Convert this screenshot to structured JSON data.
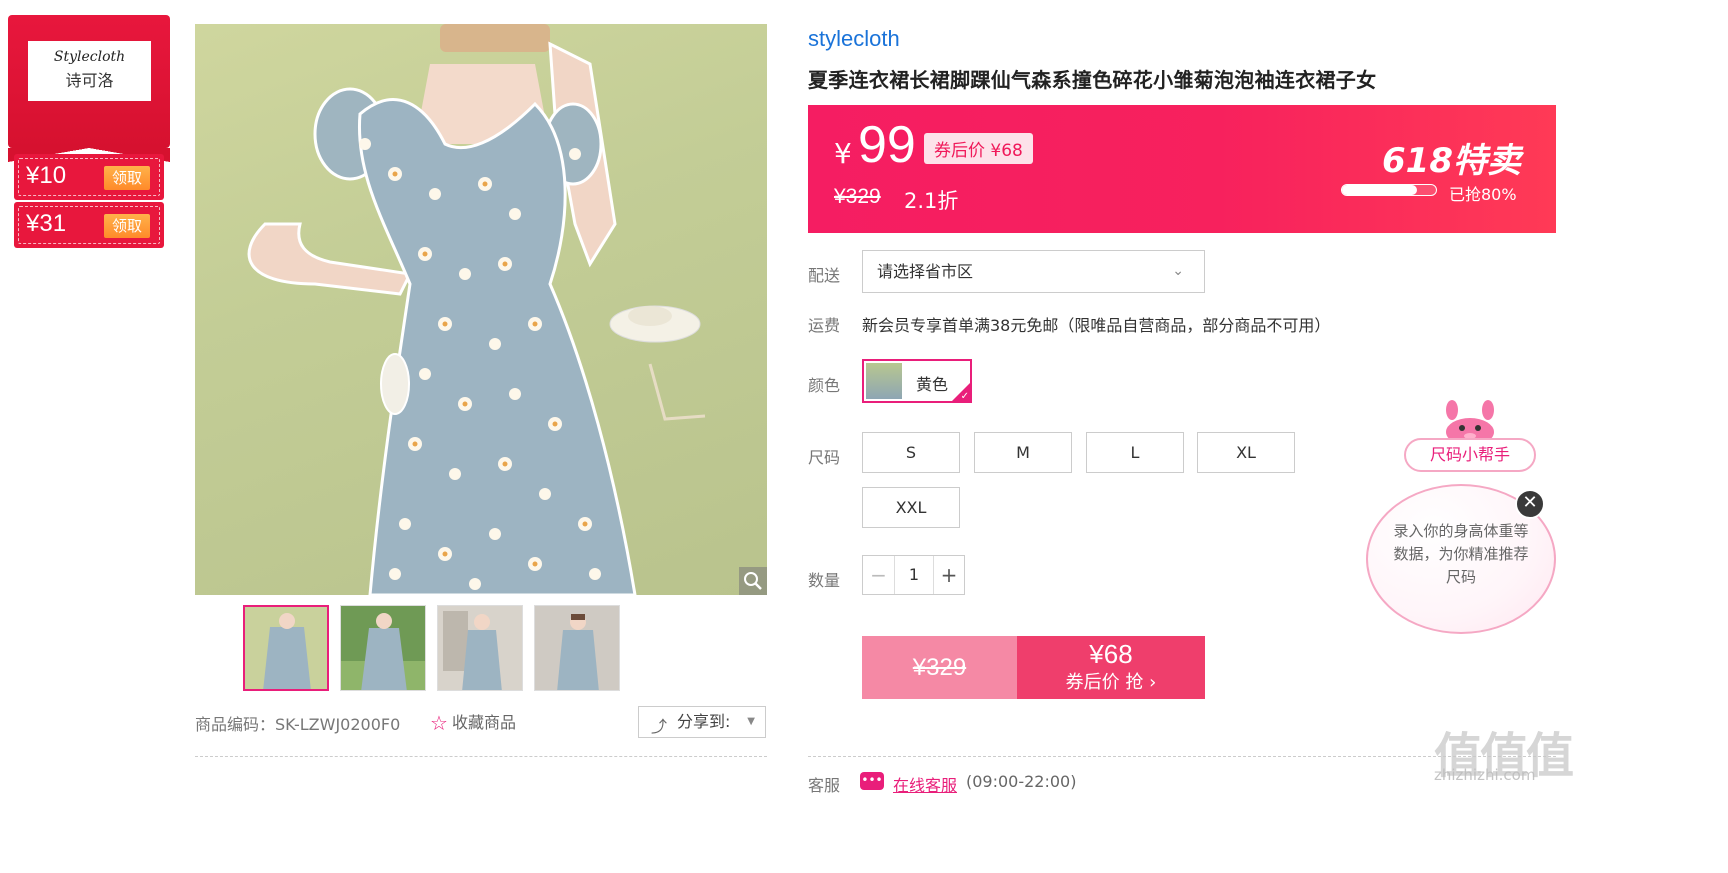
{
  "brand": {
    "name_en": "Stylecloth",
    "name_cn": "诗可洛"
  },
  "coupons": [
    {
      "amount": "¥10",
      "action": "领取"
    },
    {
      "amount": "¥31",
      "action": "领取"
    }
  ],
  "product": {
    "store": "stylecloth",
    "title": "夏季连衣裙长裙脚踝仙气森系撞色碎花小雏菊泡泡袖连衣裙子女",
    "sku_label": "商品编码：SK-LZWJ0200F0",
    "favorite_label": "收藏商品",
    "share_label": "分享到:"
  },
  "price": {
    "currency": "¥",
    "current": "99",
    "coupon_price": "券后价 ¥68",
    "original": "¥329",
    "discount": "2.1折",
    "promo_title": "618特卖",
    "progress_text": "已抢80%",
    "progress_fraction": 0.8,
    "colors": {
      "banner_start": "#f51d62",
      "banner_end": "#ff3a56",
      "accent": "#e91e7a"
    }
  },
  "delivery": {
    "label": "配送",
    "placeholder": "请选择省市区"
  },
  "shipping": {
    "label": "运费",
    "text": "新会员专享首单满38元免邮（限唯品自营商品，部分商品不可用）"
  },
  "color": {
    "label": "颜色",
    "selected": "黄色"
  },
  "size": {
    "label": "尺码",
    "options": [
      "S",
      "M",
      "L",
      "XL",
      "XXL"
    ]
  },
  "quantity": {
    "label": "数量",
    "value": "1",
    "minus": "−",
    "plus": "+"
  },
  "buy": {
    "original": "¥329",
    "price": "¥68",
    "action": "券后价 抢 ›"
  },
  "service": {
    "label": "客服",
    "link": "在线客服",
    "hours": "(09:00-22:00)"
  },
  "size_helper": {
    "title": "尺码小帮手",
    "text": "录入你的身高体重等数据，为你精准推荐尺码",
    "close": "✕"
  },
  "watermark": {
    "logo": "值值值",
    "url": "zhizhizhi.com"
  },
  "icons": {
    "zoom": "magnifier-icon",
    "favorite": "star-icon",
    "share": "share-icon",
    "service": "chat-icon",
    "close": "close-icon"
  }
}
